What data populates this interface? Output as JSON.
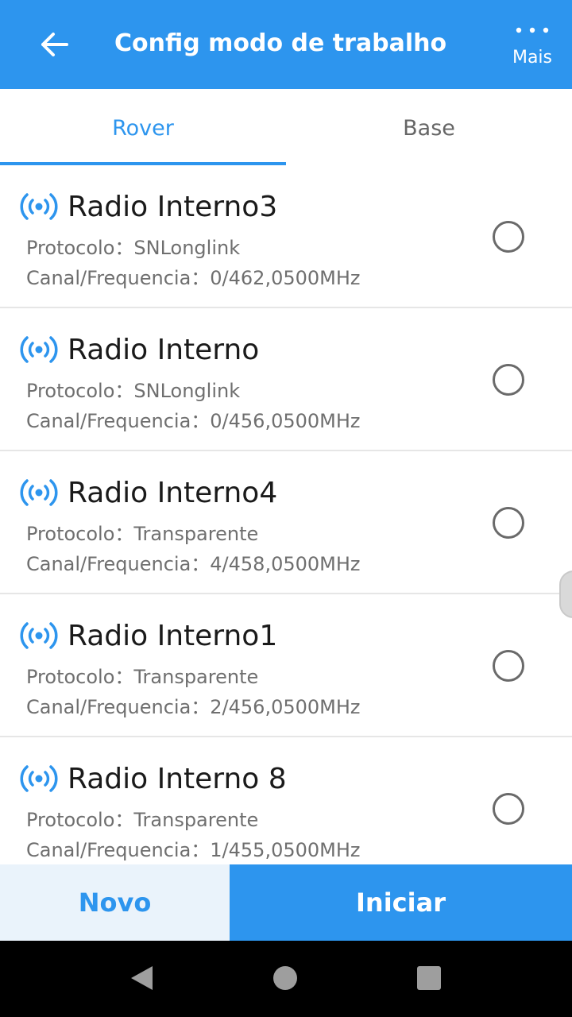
{
  "header": {
    "title": "Config modo de trabalho",
    "back_icon": "arrow-left-icon",
    "more_icon": "three-dots-icon",
    "more_label": "Mais"
  },
  "tabs": [
    {
      "label": "Rover",
      "selected": true
    },
    {
      "label": "Base",
      "selected": false
    }
  ],
  "items": [
    {
      "name": "Radio Interno3",
      "protocol": "Protocolo：SNLonglink",
      "channel": "Canal/Frequencia：0/462,0500MHz",
      "selected": false
    },
    {
      "name": "Radio Interno",
      "protocol": "Protocolo：SNLonglink",
      "channel": "Canal/Frequencia：0/456,0500MHz",
      "selected": false
    },
    {
      "name": "Radio Interno4",
      "protocol": "Protocolo：Transparente",
      "channel": "Canal/Frequencia：4/458,0500MHz",
      "selected": false
    },
    {
      "name": "Radio Interno1",
      "protocol": "Protocolo：Transparente",
      "channel": "Canal/Frequencia：2/456,0500MHz",
      "selected": false
    },
    {
      "name": "Radio Interno 8",
      "protocol": "Protocolo：Transparente",
      "channel": "Canal/Frequencia：1/455,0500MHz",
      "selected": false
    }
  ],
  "buttons": {
    "novo": "Novo",
    "iniciar": "Iniciar"
  },
  "colors": {
    "accent": "#2d95ee",
    "novo_bg": "#eaf3fb",
    "text_dark": "#1a1a1a",
    "text_muted": "#6f6f6f"
  }
}
